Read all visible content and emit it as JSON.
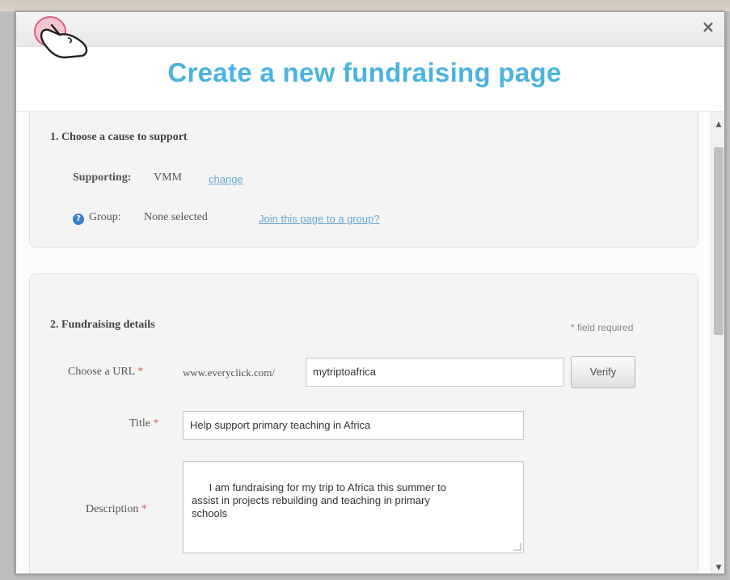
{
  "modal": {
    "title": "Create a new fundraising page",
    "close_label": "×"
  },
  "section1": {
    "heading": "1. Choose a cause to support",
    "supporting_label": "Supporting:",
    "supporting_value": "VMM",
    "change_link": "change",
    "group_label": "Group:",
    "group_value": "None selected",
    "join_link": "Join this page to a group?"
  },
  "section2": {
    "heading": "2. Fundraising details",
    "required_note": "* field required",
    "url_label": "Choose a URL",
    "url_prefix": "www.everyclick.com/",
    "url_value": "mytriptoafrica",
    "verify_button": "Verify",
    "title_label": "Title",
    "title_value": "Help support primary teaching in Africa",
    "description_label": "Description",
    "description_value": "I am fundraising for my trip to Africa this summer to\nassist in projects rebuilding and teaching in primary\nschools",
    "required_marker": "*"
  },
  "colors": {
    "title": "#4bb3e0",
    "link": "#6aa7d6",
    "required": "#e05a5a",
    "help_icon": "#3d7fc6"
  },
  "icons": {
    "logo": "pointing-hand-logo-icon",
    "help": "help-icon",
    "close": "close-icon"
  }
}
